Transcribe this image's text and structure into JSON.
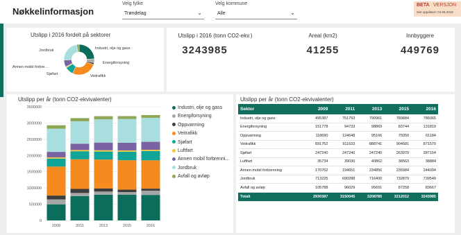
{
  "header": {
    "title": "Nøkkelinformasjon",
    "county_label": "Velg fylke",
    "county_value": "Trøndelag",
    "municipality_label": "Velg kommune",
    "municipality_value": "Alle",
    "beta_bold": "BETA",
    "beta_text": "VERSJON",
    "updated_text": "Sist oppdatert: 04.06.2018"
  },
  "kpis": {
    "utslipp_label": "Utslipp i 2016 (tonn CO2-ekv.)",
    "utslipp_value": "3243985",
    "areal_label": "Areal (km2)",
    "areal_value": "41255",
    "innbyggere_label": "Innbyggere",
    "innbyggere_value": "449769"
  },
  "donut": {
    "title": "Utslipp i 2016 fordelt på sektorer",
    "labels": [
      "Industri, olje og gass",
      "Energiforsyning",
      "Veitrafikk",
      "Sjøfart",
      "Annen mobil forbre...",
      "Jordbruk"
    ]
  },
  "bar_chart": {
    "title": "Utslipp per år (tonn CO2-ekvivalenter)",
    "y_ticks": [
      "3500000",
      "3000000",
      "2500000",
      "2000000",
      "1500000",
      "1000000",
      "500000",
      "0"
    ],
    "x_ticks": [
      "2009",
      "2011",
      "2013",
      "2015",
      "2016"
    ],
    "legend": [
      "Industri, olje og gass",
      "Energiforsyning",
      "Oppvarming",
      "Veitrafikk",
      "Sjøfart",
      "Luftfart",
      "Annen mobil forbrenni...",
      "Jordbruk",
      "Avfall og avløp"
    ]
  },
  "table": {
    "title": "Utslipp per år (tonn CO2-ekvivalenter)",
    "columns": [
      "Sektor",
      "2009",
      "2011",
      "2013",
      "2015",
      "2016"
    ],
    "rows": [
      [
        "Industri, olje og gass",
        "495387",
        "751793",
        "790961",
        "789884",
        "786065"
      ],
      [
        "Energiforsyning",
        "151778",
        "94733",
        "98869",
        "83744",
        "131819"
      ],
      [
        "Oppvarming",
        "118690",
        "124648",
        "95166",
        "75050",
        "61184"
      ],
      [
        "Veitrafikk",
        "891762",
        "911633",
        "888741",
        "904681",
        "871570"
      ],
      [
        "Sjøfart",
        "247240",
        "247240",
        "247240",
        "263970",
        "287154"
      ],
      [
        "Luftfart",
        "35734",
        "39030",
        "40862",
        "38563",
        "38884"
      ],
      [
        "Annen mobil forbrenning",
        "170762",
        "194651",
        "234856",
        "235984",
        "244094"
      ],
      [
        "Jordbruk",
        "713225",
        "690288",
        "716400",
        "732879",
        "739549"
      ],
      [
        "Avfall og avløp",
        "105788",
        "96029",
        "95691",
        "87258",
        "83667"
      ]
    ],
    "total": [
      "Totalt",
      "2930387",
      "3150045",
      "3208785",
      "3212012",
      "3243985"
    ]
  },
  "chart_data": [
    {
      "type": "pie",
      "title": "Utslipp i 2016 fordelt på sektorer",
      "categories": [
        "Industri, olje og gass",
        "Energiforsyning",
        "Oppvarming",
        "Veitrafikk",
        "Sjøfart",
        "Luftfart",
        "Annen mobil forbrenning",
        "Jordbruk",
        "Avfall og avløp"
      ],
      "values": [
        786065,
        131819,
        61184,
        871570,
        287154,
        38884,
        244094,
        739549,
        83667
      ]
    },
    {
      "type": "bar",
      "stacked": true,
      "title": "Utslipp per år (tonn CO2-ekvivalenter)",
      "categories": [
        "2009",
        "2011",
        "2013",
        "2015",
        "2016"
      ],
      "ylim": [
        0,
        3500000
      ],
      "series": [
        {
          "name": "Industri, olje og gass",
          "values": [
            495387,
            751793,
            790961,
            789884,
            786065
          ]
        },
        {
          "name": "Energiforsyning",
          "values": [
            151778,
            94733,
            98869,
            83744,
            131819
          ]
        },
        {
          "name": "Oppvarming",
          "values": [
            118690,
            124648,
            95166,
            75050,
            61184
          ]
        },
        {
          "name": "Veitrafikk",
          "values": [
            891762,
            911633,
            888741,
            904681,
            871570
          ]
        },
        {
          "name": "Sjøfart",
          "values": [
            247240,
            247240,
            247240,
            263970,
            287154
          ]
        },
        {
          "name": "Luftfart",
          "values": [
            35734,
            39030,
            40862,
            38563,
            38884
          ]
        },
        {
          "name": "Annen mobil forbrenning",
          "values": [
            170762,
            194651,
            234856,
            235984,
            244094
          ]
        },
        {
          "name": "Jordbruk",
          "values": [
            713225,
            690288,
            716400,
            732879,
            739549
          ]
        },
        {
          "name": "Avfall og avløp",
          "values": [
            105788,
            96029,
            95691,
            87258,
            83667
          ]
        }
      ]
    }
  ],
  "colors": [
    "#0b6e5d",
    "#a6a6a6",
    "#3d3d3d",
    "#f58a1f",
    "#11a59a",
    "#f2c83a",
    "#7a63a3",
    "#a8dede",
    "#8ea655"
  ]
}
